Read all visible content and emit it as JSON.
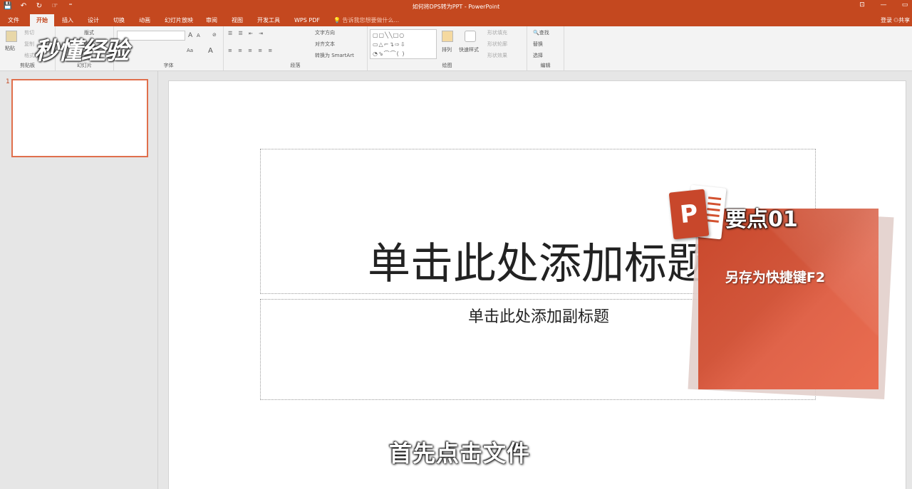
{
  "titlebar": {
    "title": "如何将DPS转为PPT - PowerPoint",
    "qat": {
      "save_icon": "💾",
      "undo_icon": "↶",
      "redo_icon": "↻",
      "touch_icon": "☞",
      "custom_icon": "⁼"
    },
    "win": {
      "ribbon_opts": "⊡",
      "minimize": "—",
      "restore": "▭",
      "close": "✕"
    }
  },
  "tabs": [
    "文件",
    "开始",
    "插入",
    "设计",
    "切换",
    "动画",
    "幻灯片放映",
    "审阅",
    "视图",
    "开发工具",
    "WPS PDF"
  ],
  "active_tab": "开始",
  "tellme": "告诉我您想要做什么...",
  "login": "登录",
  "share": "共享",
  "ribbon": {
    "clipboard": {
      "label": "剪贴板",
      "paste": "粘贴",
      "cut": "剪切",
      "copy": "复制",
      "format": "格式刷"
    },
    "slides": {
      "label": "幻灯片",
      "layout": "版式",
      "reset": "重置",
      "section": "节"
    },
    "font": {
      "label": "字体",
      "grow": "A",
      "shrink": "A",
      "clear": "⊘",
      "case": "Aa",
      "color": "A"
    },
    "paragraph": {
      "label": "段落",
      "text_dir": "文字方向",
      "align_text": "对齐文本",
      "smartart": "转换为 SmartArt"
    },
    "drawing": {
      "label": "绘图",
      "arrange": "排列",
      "quick_styles": "快速样式",
      "fill": "形状填充",
      "outline": "形状轮廓",
      "effects": "形状效果",
      "shapes": "▢▢╲╲□○ ▭△⌐↴⇨⇩ ◔⇘⌒⌒( )"
    },
    "editing": {
      "label": "编辑",
      "find": "查找",
      "replace": "替换",
      "select": "选择"
    }
  },
  "watermark": "秒懂经验",
  "slide_panel": {
    "number": "1"
  },
  "slide": {
    "title_placeholder": "单击此处添加标题",
    "subtitle_placeholder": "单击此处添加副标题"
  },
  "overlay": {
    "logo_letter": "P",
    "heading": "要点01",
    "text": "另存为快捷键F2"
  },
  "caption": "首先点击文件"
}
